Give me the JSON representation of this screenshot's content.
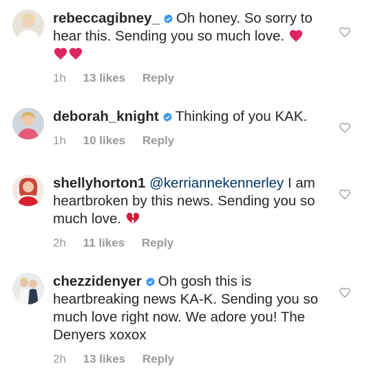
{
  "comments": [
    {
      "username": "rebeccagibney_",
      "verified": true,
      "text": "Oh honey. So sorry to hear this. Sending you so much love.",
      "emoji_after": [
        "red-heart",
        "red-heart",
        "red-heart"
      ],
      "time": "1h",
      "likes": "13 likes",
      "reply": "Reply"
    },
    {
      "username": "deborah_knight",
      "verified": true,
      "text": "Thinking of you KAK.",
      "time": "1h",
      "likes": "10 likes",
      "reply": "Reply"
    },
    {
      "username": "shellyhorton1",
      "verified": false,
      "mention": "@kerriannekennerley",
      "text": "I am heartbroken by this news. Sending you so much love.",
      "emoji_after": [
        "broken-heart"
      ],
      "time": "2h",
      "likes": "11 likes",
      "reply": "Reply"
    },
    {
      "username": "chezzidenyer",
      "verified": true,
      "text": "Oh gosh this is heartbreaking news KA-K. Sending you so much love right now. We adore you! The Denyers xoxox",
      "time": "2h",
      "likes": "13 likes",
      "reply": "Reply"
    }
  ],
  "colors": {
    "text": "#262626",
    "meta": "#999999",
    "verified": "#3897f0",
    "heart": "#e0245e"
  },
  "icons": {
    "like": "heart-outline-icon",
    "verified": "verified-badge-icon"
  }
}
